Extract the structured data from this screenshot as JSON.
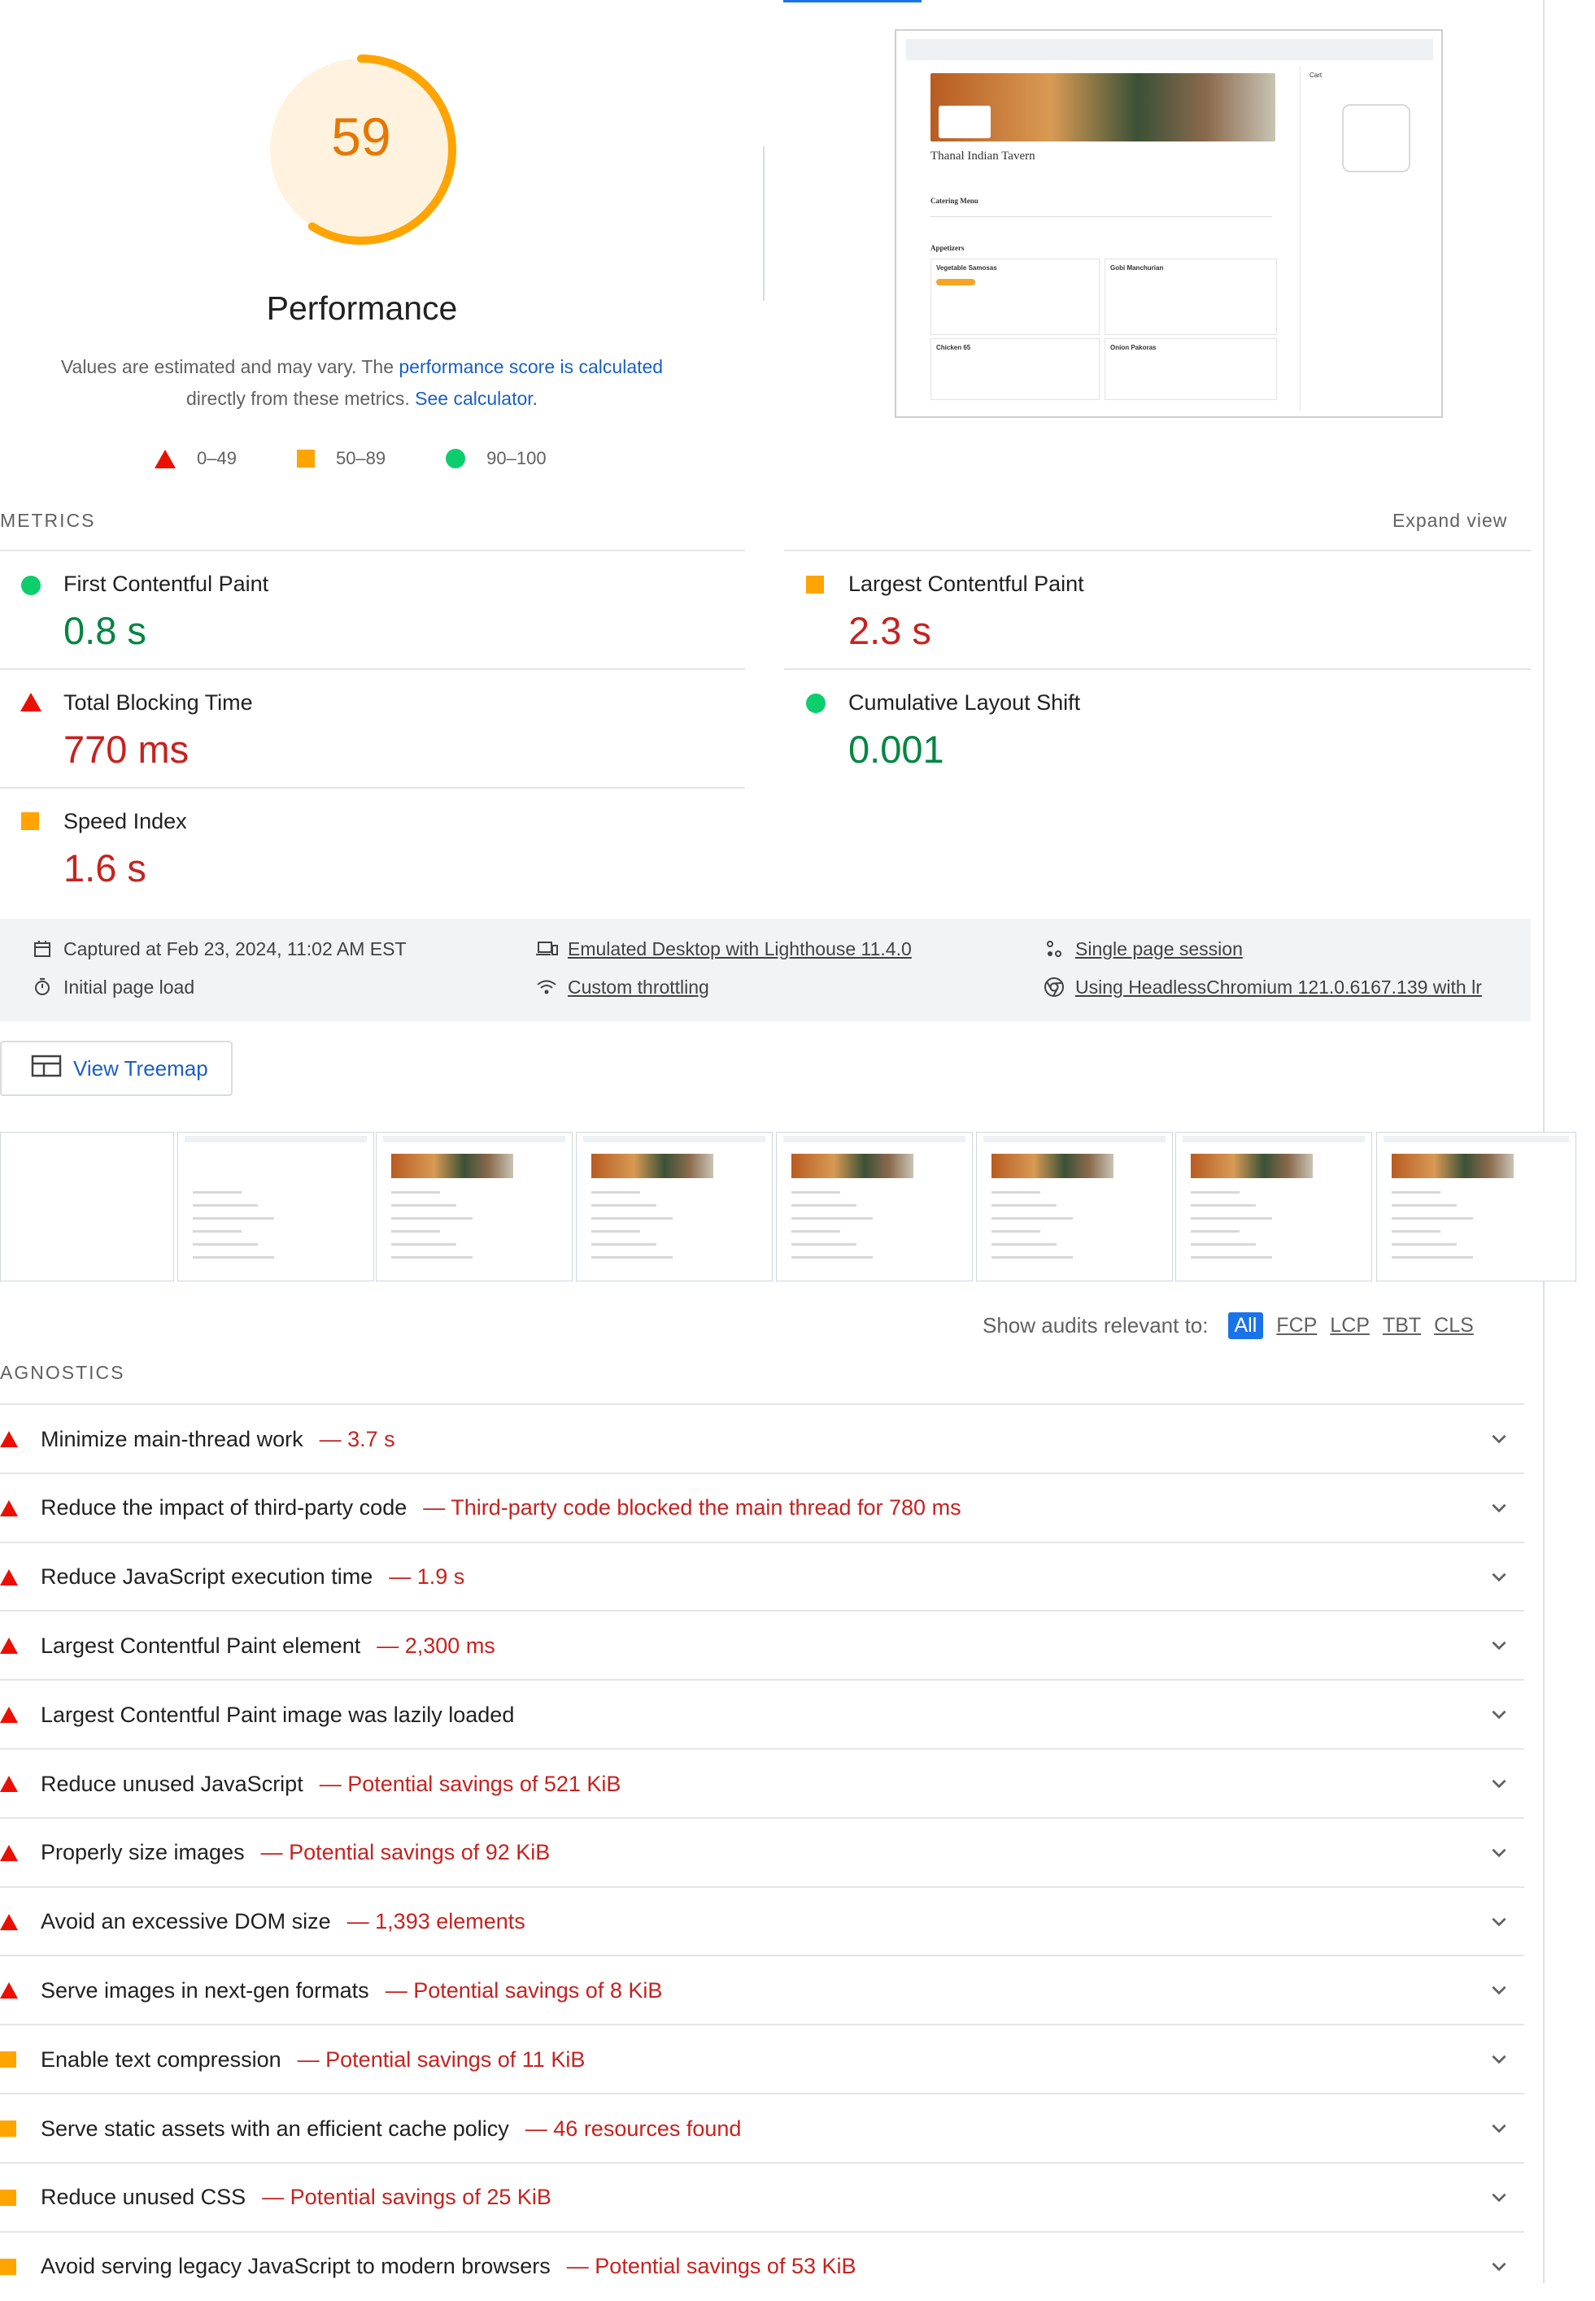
{
  "score": {
    "value": "59",
    "fraction": 0.59,
    "color": "#ffa400"
  },
  "performance": {
    "title": "Performance",
    "desc_prefix": "Values are estimated and may vary. The ",
    "desc_link": "performance score is calculated",
    "desc_mid": "directly from these metrics. ",
    "desc_link2": "See calculator."
  },
  "legend": [
    {
      "label": "0–49",
      "icon": "triangle-fail"
    },
    {
      "label": "50–89",
      "icon": "square-average"
    },
    {
      "label": "90–100",
      "icon": "circle-pass"
    }
  ],
  "thumbnail": {
    "restaurant_name": "Thanal Indian Tavern",
    "menu_label": "Catering Menu",
    "section": "Appetizers",
    "items": [
      "Vegetable Samosas",
      "Gobi Manchurian",
      "Chicken 65",
      "Onion Pakoras"
    ],
    "cart_label": "Cart"
  },
  "metrics": {
    "label": "METRICS",
    "expand_label": "Expand view",
    "fcp": {
      "name": "First Contentful Paint",
      "value": "0.8 s"
    },
    "lcp": {
      "name": "Largest Contentful Paint",
      "value": "2.3 s"
    },
    "tbt": {
      "name": "Total Blocking Time",
      "value": "770 ms"
    },
    "cls": {
      "name": "Cumulative Layout Shift",
      "value": "0.001"
    },
    "si": {
      "name": "Speed Index",
      "value": "1.6 s"
    }
  },
  "info": {
    "captured": "Captured at Feb 23, 2024, 11:02 AM EST",
    "initial": "Initial page load",
    "emulated": "Emulated Desktop with Lighthouse 11.4.0",
    "throttling": "Custom throttling",
    "session": "Single page session",
    "browser": "Using HeadlessChromium 121.0.6167.139 with lr"
  },
  "treemap_label": "View Treemap",
  "filter": {
    "label": "Show audits relevant to:",
    "all": "All",
    "fcp": "FCP",
    "lcp": "LCP",
    "tbt": "TBT",
    "cls": "CLS"
  },
  "diagnostics_label": "AGNOSTICS",
  "audits": [
    {
      "icon": "fail",
      "title": "Minimize main-thread work",
      "detail": "— 3.7 s"
    },
    {
      "icon": "fail",
      "title": "Reduce the impact of third-party code",
      "detail": "— Third-party code blocked the main thread for 780 ms"
    },
    {
      "icon": "fail",
      "title": "Reduce JavaScript execution time",
      "detail": "— 1.9 s"
    },
    {
      "icon": "fail",
      "title": "Largest Contentful Paint element",
      "detail": "— 2,300 ms"
    },
    {
      "icon": "fail",
      "title": "Largest Contentful Paint image was lazily loaded",
      "detail": ""
    },
    {
      "icon": "fail",
      "title": "Reduce unused JavaScript",
      "detail": "— Potential savings of 521 KiB"
    },
    {
      "icon": "fail",
      "title": "Properly size images",
      "detail": "— Potential savings of 92 KiB"
    },
    {
      "icon": "fail",
      "title": "Avoid an excessive DOM size",
      "detail": "— 1,393 elements"
    },
    {
      "icon": "fail",
      "title": "Serve images in next-gen formats",
      "detail": "— Potential savings of 8 KiB"
    },
    {
      "icon": "average",
      "title": "Enable text compression",
      "detail": "— Potential savings of 11 KiB"
    },
    {
      "icon": "average",
      "title": "Serve static assets with an efficient cache policy",
      "detail": "— 46 resources found"
    },
    {
      "icon": "average",
      "title": "Reduce unused CSS",
      "detail": "— Potential savings of 25 KiB"
    },
    {
      "icon": "average",
      "title": "Avoid serving legacy JavaScript to modern browsers",
      "detail": "— Potential savings of 53 KiB"
    }
  ]
}
